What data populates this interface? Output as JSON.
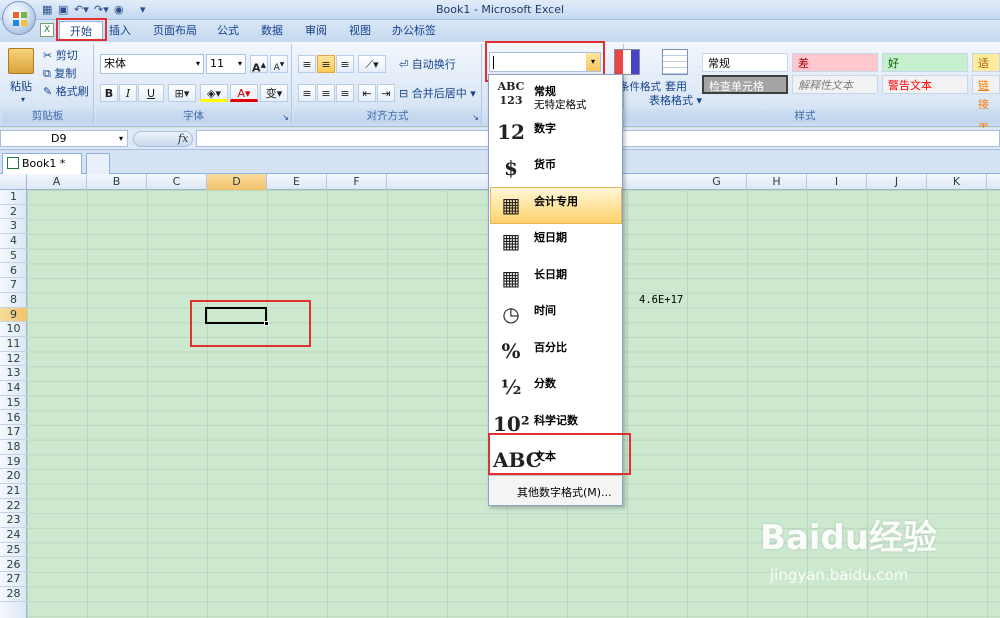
{
  "window": {
    "title": "Book1 - Microsoft Excel"
  },
  "ribbon_tabs": [
    "开始",
    "插入",
    "页面布局",
    "公式",
    "数据",
    "审阅",
    "视图",
    "办公标签"
  ],
  "clipboard": {
    "paste": "粘贴",
    "cut": "剪切",
    "copy": "复制",
    "format_painter": "格式刷",
    "label": "剪贴板"
  },
  "font": {
    "name": "宋体",
    "size": "11",
    "bold": "B",
    "italic": "I",
    "underline": "U",
    "label": "字体",
    "grow": "A",
    "shrink": "A",
    "phonetic": "变"
  },
  "alignment": {
    "wrap": "自动换行",
    "merge": "合并后居中",
    "label": "对齐方式"
  },
  "number": {
    "format_value": ""
  },
  "styles_group": {
    "cond_format": "条件格式",
    "table_format_1": "套用",
    "table_format_2": "表格格式",
    "label": "样式",
    "cells": [
      {
        "text": "常规",
        "bg": "#ffffff",
        "color": "#000000"
      },
      {
        "text": "差",
        "bg": "#ffc7ce",
        "color": "#9c0006"
      },
      {
        "text": "好",
        "bg": "#c6efce",
        "color": "#006100"
      },
      {
        "text": "适中",
        "bg": "#ffeb9c",
        "color": "#9c6500"
      },
      {
        "text": "检查单元格",
        "bg": "#a5a5a5",
        "color": "#ffffff"
      },
      {
        "text": "解释性文本",
        "bg": "#f2f2f2",
        "color": "#7f7f7f"
      },
      {
        "text": "警告文本",
        "bg": "#f2f2f2",
        "color": "#ff0000"
      },
      {
        "text": "链接单",
        "bg": "#f2f2f2",
        "color": "#fa7d00"
      }
    ]
  },
  "formula_bar": {
    "cell_ref": "D9",
    "fx": "fx"
  },
  "workbook_tab": {
    "name": "Book1 *",
    "close": "×"
  },
  "columns": [
    "A",
    "B",
    "C",
    "D",
    "E",
    "F",
    "G",
    "H",
    "I",
    "J",
    "K"
  ],
  "rows": [
    "1",
    "2",
    "3",
    "4",
    "5",
    "6",
    "7",
    "8",
    "9",
    "10",
    "11",
    "12",
    "13",
    "14",
    "15",
    "16",
    "17",
    "18",
    "19",
    "20",
    "21",
    "22",
    "23",
    "24",
    "25",
    "26",
    "27",
    "28"
  ],
  "cell_value": "4.6E+17",
  "dropdown": {
    "items": [
      {
        "icon": "ABC 123",
        "label": "常规",
        "sub": "无特定格式"
      },
      {
        "icon": "12",
        "label": "数字"
      },
      {
        "icon": "$",
        "label": "货币"
      },
      {
        "icon": "▦",
        "label": "会计专用"
      },
      {
        "icon": "▦",
        "label": "短日期"
      },
      {
        "icon": "▦",
        "label": "长日期"
      },
      {
        "icon": "◷",
        "label": "时间"
      },
      {
        "icon": "%",
        "label": "百分比"
      },
      {
        "icon": "½",
        "label": "分数"
      },
      {
        "icon": "10²",
        "label": "科学记数"
      },
      {
        "icon": "ABC",
        "label": "文本"
      }
    ],
    "more": "其他数字格式(M)..."
  },
  "watermark": {
    "brand": "Baidu经验",
    "url": "jingyan.baidu.com"
  }
}
